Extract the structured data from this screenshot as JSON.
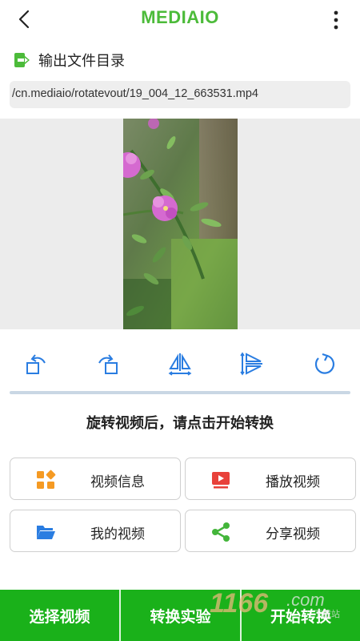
{
  "header": {
    "title": "MEDIAIO",
    "brand_color": "#4cbb3a"
  },
  "output": {
    "label": "输出文件目录",
    "path": "/cn.mediaio/rotatevout/19_004_12_663531.mp4"
  },
  "tools": [
    "rotate-left-icon",
    "rotate-right-icon",
    "flip-horizontal-icon",
    "flip-vertical-icon",
    "reset-rotation-icon"
  ],
  "hint": "旋转视频后，请点击开始转换",
  "cards": {
    "video_info": "视频信息",
    "play_video": "播放视频",
    "my_videos": "我的视频",
    "share_video": "分享视频"
  },
  "bottom": {
    "select": "选择视频",
    "lab": "转换实验",
    "start": "开始转换",
    "bar_color": "#1ab11a"
  },
  "watermark": {
    "text": "1166",
    "suffix": ".com"
  }
}
